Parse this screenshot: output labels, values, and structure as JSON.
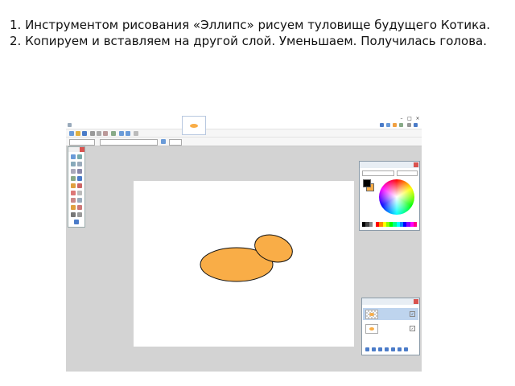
{
  "instructions": {
    "line1": "1. Инструментом рисования «Эллипс» рисуем туловище будущего Котика.",
    "line2": "2. Копируем и вставляем на другой слой. Уменьшаем. Получилась голова."
  },
  "app": {
    "colors": {
      "accent": "#f9ad47",
      "outline": "#111111",
      "workspace": "#d3d3d3",
      "selection": "#bed4ee"
    },
    "toolbar_icons": [
      "new-icon",
      "open-icon",
      "save-icon",
      "cut-icon",
      "copy-icon",
      "paste-icon",
      "crop-icon",
      "undo-icon",
      "redo-icon",
      "grid-icon"
    ],
    "canvas": {
      "shapes": [
        "body-ellipse",
        "head-ellipse"
      ]
    },
    "colors_panel": {
      "primary_color": "#000000",
      "secondary_color": "#f9ad47"
    },
    "layers_panel": {
      "layers": [
        {
          "selected": true,
          "thumb": "transparent-with-shape"
        },
        {
          "selected": false,
          "thumb": "white-with-shape"
        }
      ]
    }
  }
}
